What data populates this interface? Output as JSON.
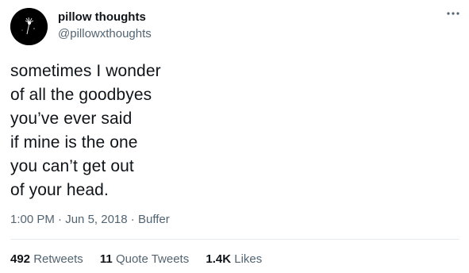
{
  "author": {
    "display_name": "pillow thoughts",
    "handle": "@pillowxthoughts",
    "avatar_icon": "dandelion-seed-icon"
  },
  "more_icon": "more-horizontal-icon",
  "tweet": {
    "lines": [
      "sometimes I wonder",
      "of all the goodbyes",
      "you’ve ever said",
      "if mine is the one",
      "you can’t get out",
      "of your head."
    ]
  },
  "meta": {
    "time": "1:00 PM",
    "sep1": " · ",
    "date": "Jun 5, 2018",
    "sep2": " · ",
    "source": "Buffer"
  },
  "stats": {
    "retweets": {
      "count": "492",
      "label": "Retweets"
    },
    "quotes": {
      "count": "11",
      "label": "Quote Tweets"
    },
    "likes": {
      "count": "1.4K",
      "label": "Likes"
    }
  },
  "colors": {
    "text": "#0f1419",
    "secondary": "#536471",
    "divider": "#e6ecf0",
    "avatar_bg": "#000000"
  }
}
